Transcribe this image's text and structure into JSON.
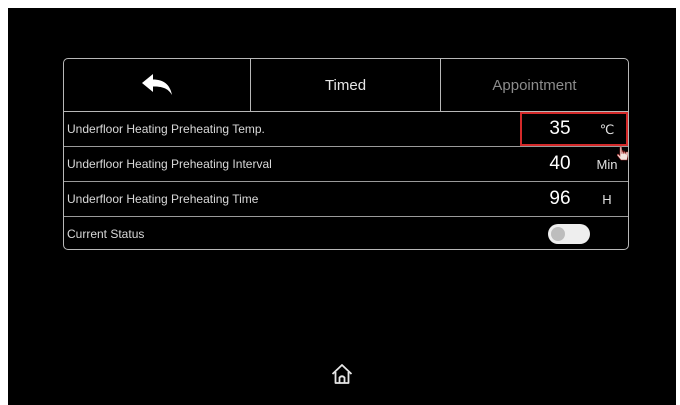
{
  "tabs": {
    "back_icon": "back-arrow-icon",
    "timed": "Timed",
    "appointment": "Appointment"
  },
  "rows": [
    {
      "label": "Underfloor Heating Preheating Temp.",
      "value": "35",
      "unit": "℃"
    },
    {
      "label": "Underfloor Heating Preheating Interval",
      "value": "40",
      "unit": "Min"
    },
    {
      "label": "Underfloor Heating Preheating Time",
      "value": "96",
      "unit": "H"
    },
    {
      "label": "Current Status",
      "toggle_on": false
    }
  ],
  "footer": {
    "home_icon": "home-icon"
  },
  "colors": {
    "background": "#000000",
    "border": "#b8b8b8",
    "highlight": "#d42a2a",
    "toggle": "#eeeeee"
  }
}
